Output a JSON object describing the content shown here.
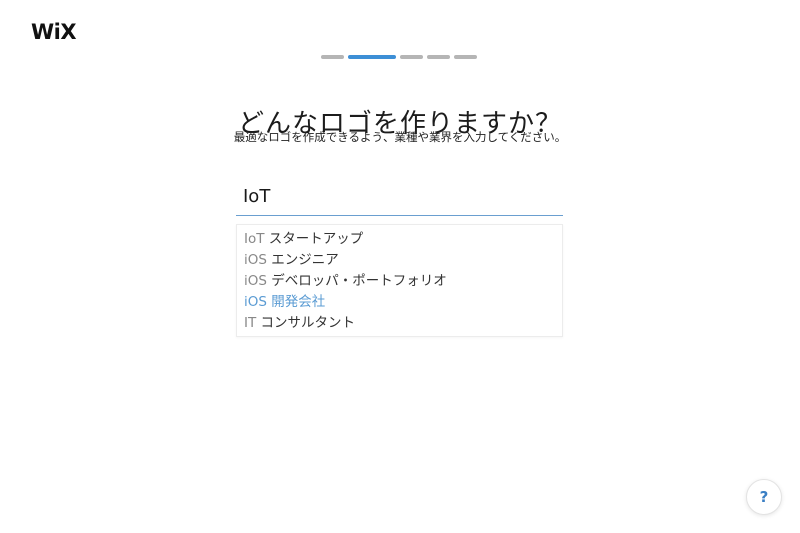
{
  "brand": {
    "logo_text": "WiX"
  },
  "progress": {
    "total_steps": 5,
    "current_step": 2
  },
  "header": {
    "title": "どんなロゴを作りますか？",
    "subtitle": "最適なロゴを作成できるよう、業種や業界を入力してください。"
  },
  "search": {
    "value": "IoT",
    "placeholder": ""
  },
  "suggestions": [
    {
      "prefix": "IoT",
      "rest": " スタートアップ",
      "highlighted": false
    },
    {
      "prefix": "iOS",
      "rest": " エンジニア",
      "highlighted": false
    },
    {
      "prefix": "iOS",
      "rest": " デベロッパ・ポートフォリオ",
      "highlighted": false
    },
    {
      "prefix": "iOS",
      "rest": " 開発会社",
      "highlighted": true
    },
    {
      "prefix": "IT",
      "rest": " コンサルタント",
      "highlighted": false
    }
  ],
  "help": {
    "label": "?"
  },
  "colors": {
    "accent": "#3d8fd6",
    "highlight_text": "#5a9bd3",
    "progress_inactive": "#b5b5b5"
  }
}
